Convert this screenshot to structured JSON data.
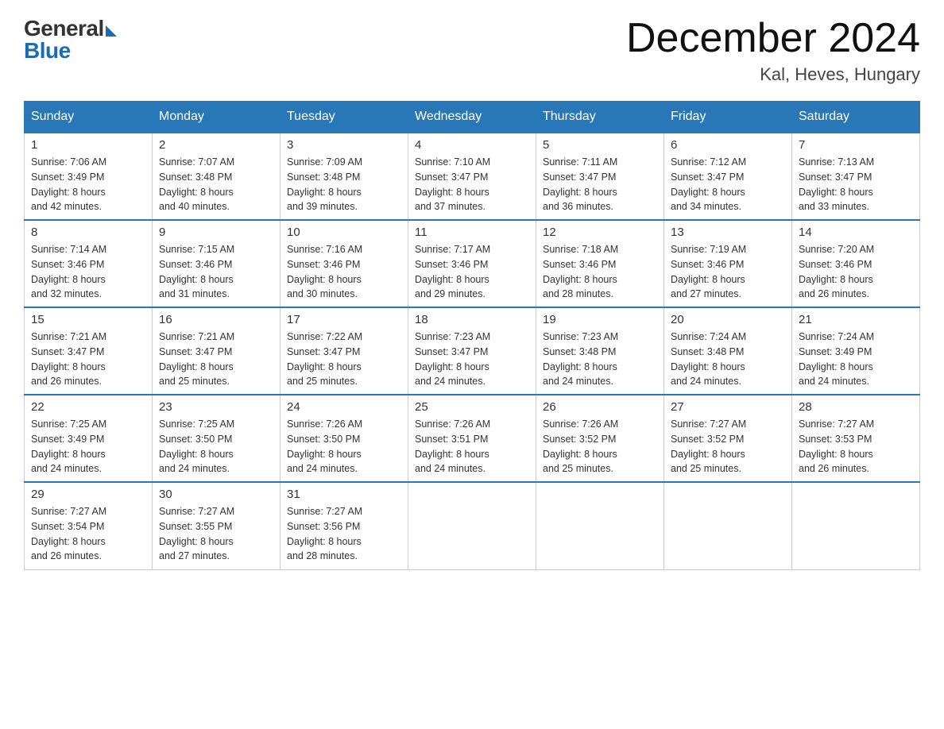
{
  "header": {
    "logo_general": "General",
    "logo_blue": "Blue",
    "month_year": "December 2024",
    "location": "Kal, Heves, Hungary"
  },
  "days_of_week": [
    "Sunday",
    "Monday",
    "Tuesday",
    "Wednesday",
    "Thursday",
    "Friday",
    "Saturday"
  ],
  "weeks": [
    [
      {
        "day": "1",
        "sunrise": "7:06 AM",
        "sunset": "3:49 PM",
        "daylight": "8 hours and 42 minutes."
      },
      {
        "day": "2",
        "sunrise": "7:07 AM",
        "sunset": "3:48 PM",
        "daylight": "8 hours and 40 minutes."
      },
      {
        "day": "3",
        "sunrise": "7:09 AM",
        "sunset": "3:48 PM",
        "daylight": "8 hours and 39 minutes."
      },
      {
        "day": "4",
        "sunrise": "7:10 AM",
        "sunset": "3:47 PM",
        "daylight": "8 hours and 37 minutes."
      },
      {
        "day": "5",
        "sunrise": "7:11 AM",
        "sunset": "3:47 PM",
        "daylight": "8 hours and 36 minutes."
      },
      {
        "day": "6",
        "sunrise": "7:12 AM",
        "sunset": "3:47 PM",
        "daylight": "8 hours and 34 minutes."
      },
      {
        "day": "7",
        "sunrise": "7:13 AM",
        "sunset": "3:47 PM",
        "daylight": "8 hours and 33 minutes."
      }
    ],
    [
      {
        "day": "8",
        "sunrise": "7:14 AM",
        "sunset": "3:46 PM",
        "daylight": "8 hours and 32 minutes."
      },
      {
        "day": "9",
        "sunrise": "7:15 AM",
        "sunset": "3:46 PM",
        "daylight": "8 hours and 31 minutes."
      },
      {
        "day": "10",
        "sunrise": "7:16 AM",
        "sunset": "3:46 PM",
        "daylight": "8 hours and 30 minutes."
      },
      {
        "day": "11",
        "sunrise": "7:17 AM",
        "sunset": "3:46 PM",
        "daylight": "8 hours and 29 minutes."
      },
      {
        "day": "12",
        "sunrise": "7:18 AM",
        "sunset": "3:46 PM",
        "daylight": "8 hours and 28 minutes."
      },
      {
        "day": "13",
        "sunrise": "7:19 AM",
        "sunset": "3:46 PM",
        "daylight": "8 hours and 27 minutes."
      },
      {
        "day": "14",
        "sunrise": "7:20 AM",
        "sunset": "3:46 PM",
        "daylight": "8 hours and 26 minutes."
      }
    ],
    [
      {
        "day": "15",
        "sunrise": "7:21 AM",
        "sunset": "3:47 PM",
        "daylight": "8 hours and 26 minutes."
      },
      {
        "day": "16",
        "sunrise": "7:21 AM",
        "sunset": "3:47 PM",
        "daylight": "8 hours and 25 minutes."
      },
      {
        "day": "17",
        "sunrise": "7:22 AM",
        "sunset": "3:47 PM",
        "daylight": "8 hours and 25 minutes."
      },
      {
        "day": "18",
        "sunrise": "7:23 AM",
        "sunset": "3:47 PM",
        "daylight": "8 hours and 24 minutes."
      },
      {
        "day": "19",
        "sunrise": "7:23 AM",
        "sunset": "3:48 PM",
        "daylight": "8 hours and 24 minutes."
      },
      {
        "day": "20",
        "sunrise": "7:24 AM",
        "sunset": "3:48 PM",
        "daylight": "8 hours and 24 minutes."
      },
      {
        "day": "21",
        "sunrise": "7:24 AM",
        "sunset": "3:49 PM",
        "daylight": "8 hours and 24 minutes."
      }
    ],
    [
      {
        "day": "22",
        "sunrise": "7:25 AM",
        "sunset": "3:49 PM",
        "daylight": "8 hours and 24 minutes."
      },
      {
        "day": "23",
        "sunrise": "7:25 AM",
        "sunset": "3:50 PM",
        "daylight": "8 hours and 24 minutes."
      },
      {
        "day": "24",
        "sunrise": "7:26 AM",
        "sunset": "3:50 PM",
        "daylight": "8 hours and 24 minutes."
      },
      {
        "day": "25",
        "sunrise": "7:26 AM",
        "sunset": "3:51 PM",
        "daylight": "8 hours and 24 minutes."
      },
      {
        "day": "26",
        "sunrise": "7:26 AM",
        "sunset": "3:52 PM",
        "daylight": "8 hours and 25 minutes."
      },
      {
        "day": "27",
        "sunrise": "7:27 AM",
        "sunset": "3:52 PM",
        "daylight": "8 hours and 25 minutes."
      },
      {
        "day": "28",
        "sunrise": "7:27 AM",
        "sunset": "3:53 PM",
        "daylight": "8 hours and 26 minutes."
      }
    ],
    [
      {
        "day": "29",
        "sunrise": "7:27 AM",
        "sunset": "3:54 PM",
        "daylight": "8 hours and 26 minutes."
      },
      {
        "day": "30",
        "sunrise": "7:27 AM",
        "sunset": "3:55 PM",
        "daylight": "8 hours and 27 minutes."
      },
      {
        "day": "31",
        "sunrise": "7:27 AM",
        "sunset": "3:56 PM",
        "daylight": "8 hours and 28 minutes."
      },
      null,
      null,
      null,
      null
    ]
  ],
  "labels": {
    "sunrise": "Sunrise:",
    "sunset": "Sunset:",
    "daylight": "Daylight:"
  }
}
